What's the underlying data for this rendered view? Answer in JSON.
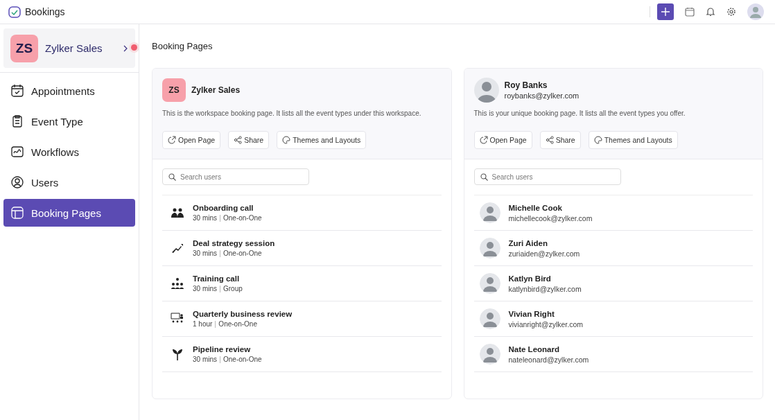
{
  "app": {
    "title": "Bookings"
  },
  "workspace": {
    "initials": "ZS",
    "name": "Zylker Sales"
  },
  "sidebar": {
    "items": [
      {
        "label": "Appointments",
        "selected": false
      },
      {
        "label": "Event Type",
        "selected": false
      },
      {
        "label": "Workflows",
        "selected": false
      },
      {
        "label": "Users",
        "selected": false
      },
      {
        "label": "Booking Pages",
        "selected": true
      }
    ]
  },
  "page_title": "Booking Pages",
  "cards": [
    {
      "kind": "workspace",
      "initials": "ZS",
      "title": "Zylker Sales",
      "description": "This is the workspace booking page. It lists all the event types under this workspace.",
      "buttons": [
        "Open Page",
        "Share",
        "Themes and Layouts"
      ],
      "search": {
        "placeholder": "Search users"
      },
      "items": [
        {
          "title": "Onboarding call",
          "duration": "30 mins",
          "type": "One-on-One"
        },
        {
          "title": "Deal strategy session",
          "duration": "30 mins",
          "type": "One-on-One"
        },
        {
          "title": "Training call",
          "duration": "30 mins",
          "type": "Group"
        },
        {
          "title": "Quarterly business review",
          "duration": "1 hour",
          "type": "One-on-One"
        },
        {
          "title": "Pipeline review",
          "duration": "30 mins",
          "type": "One-on-One"
        }
      ]
    },
    {
      "kind": "personal",
      "title": "Roy Banks",
      "email": "roybanks@zylker.com",
      "description": "This is your unique booking page. It lists all the event types you offer.",
      "buttons": [
        "Open Page",
        "Share",
        "Themes and Layouts"
      ],
      "search": {
        "placeholder": "Search users"
      },
      "items": [
        {
          "title": "Michelle Cook",
          "email": "michellecook@zylker.com"
        },
        {
          "title": "Zuri Aiden",
          "email": "zuriaiden@zylker.com"
        },
        {
          "title": "Katlyn Bird",
          "email": "katlynbird@zylker.com"
        },
        {
          "title": "Vivian Right",
          "email": "vivianright@zylker.com"
        },
        {
          "title": "Nate Leonard",
          "email": "nateleonard@zylker.com"
        }
      ]
    }
  ]
}
